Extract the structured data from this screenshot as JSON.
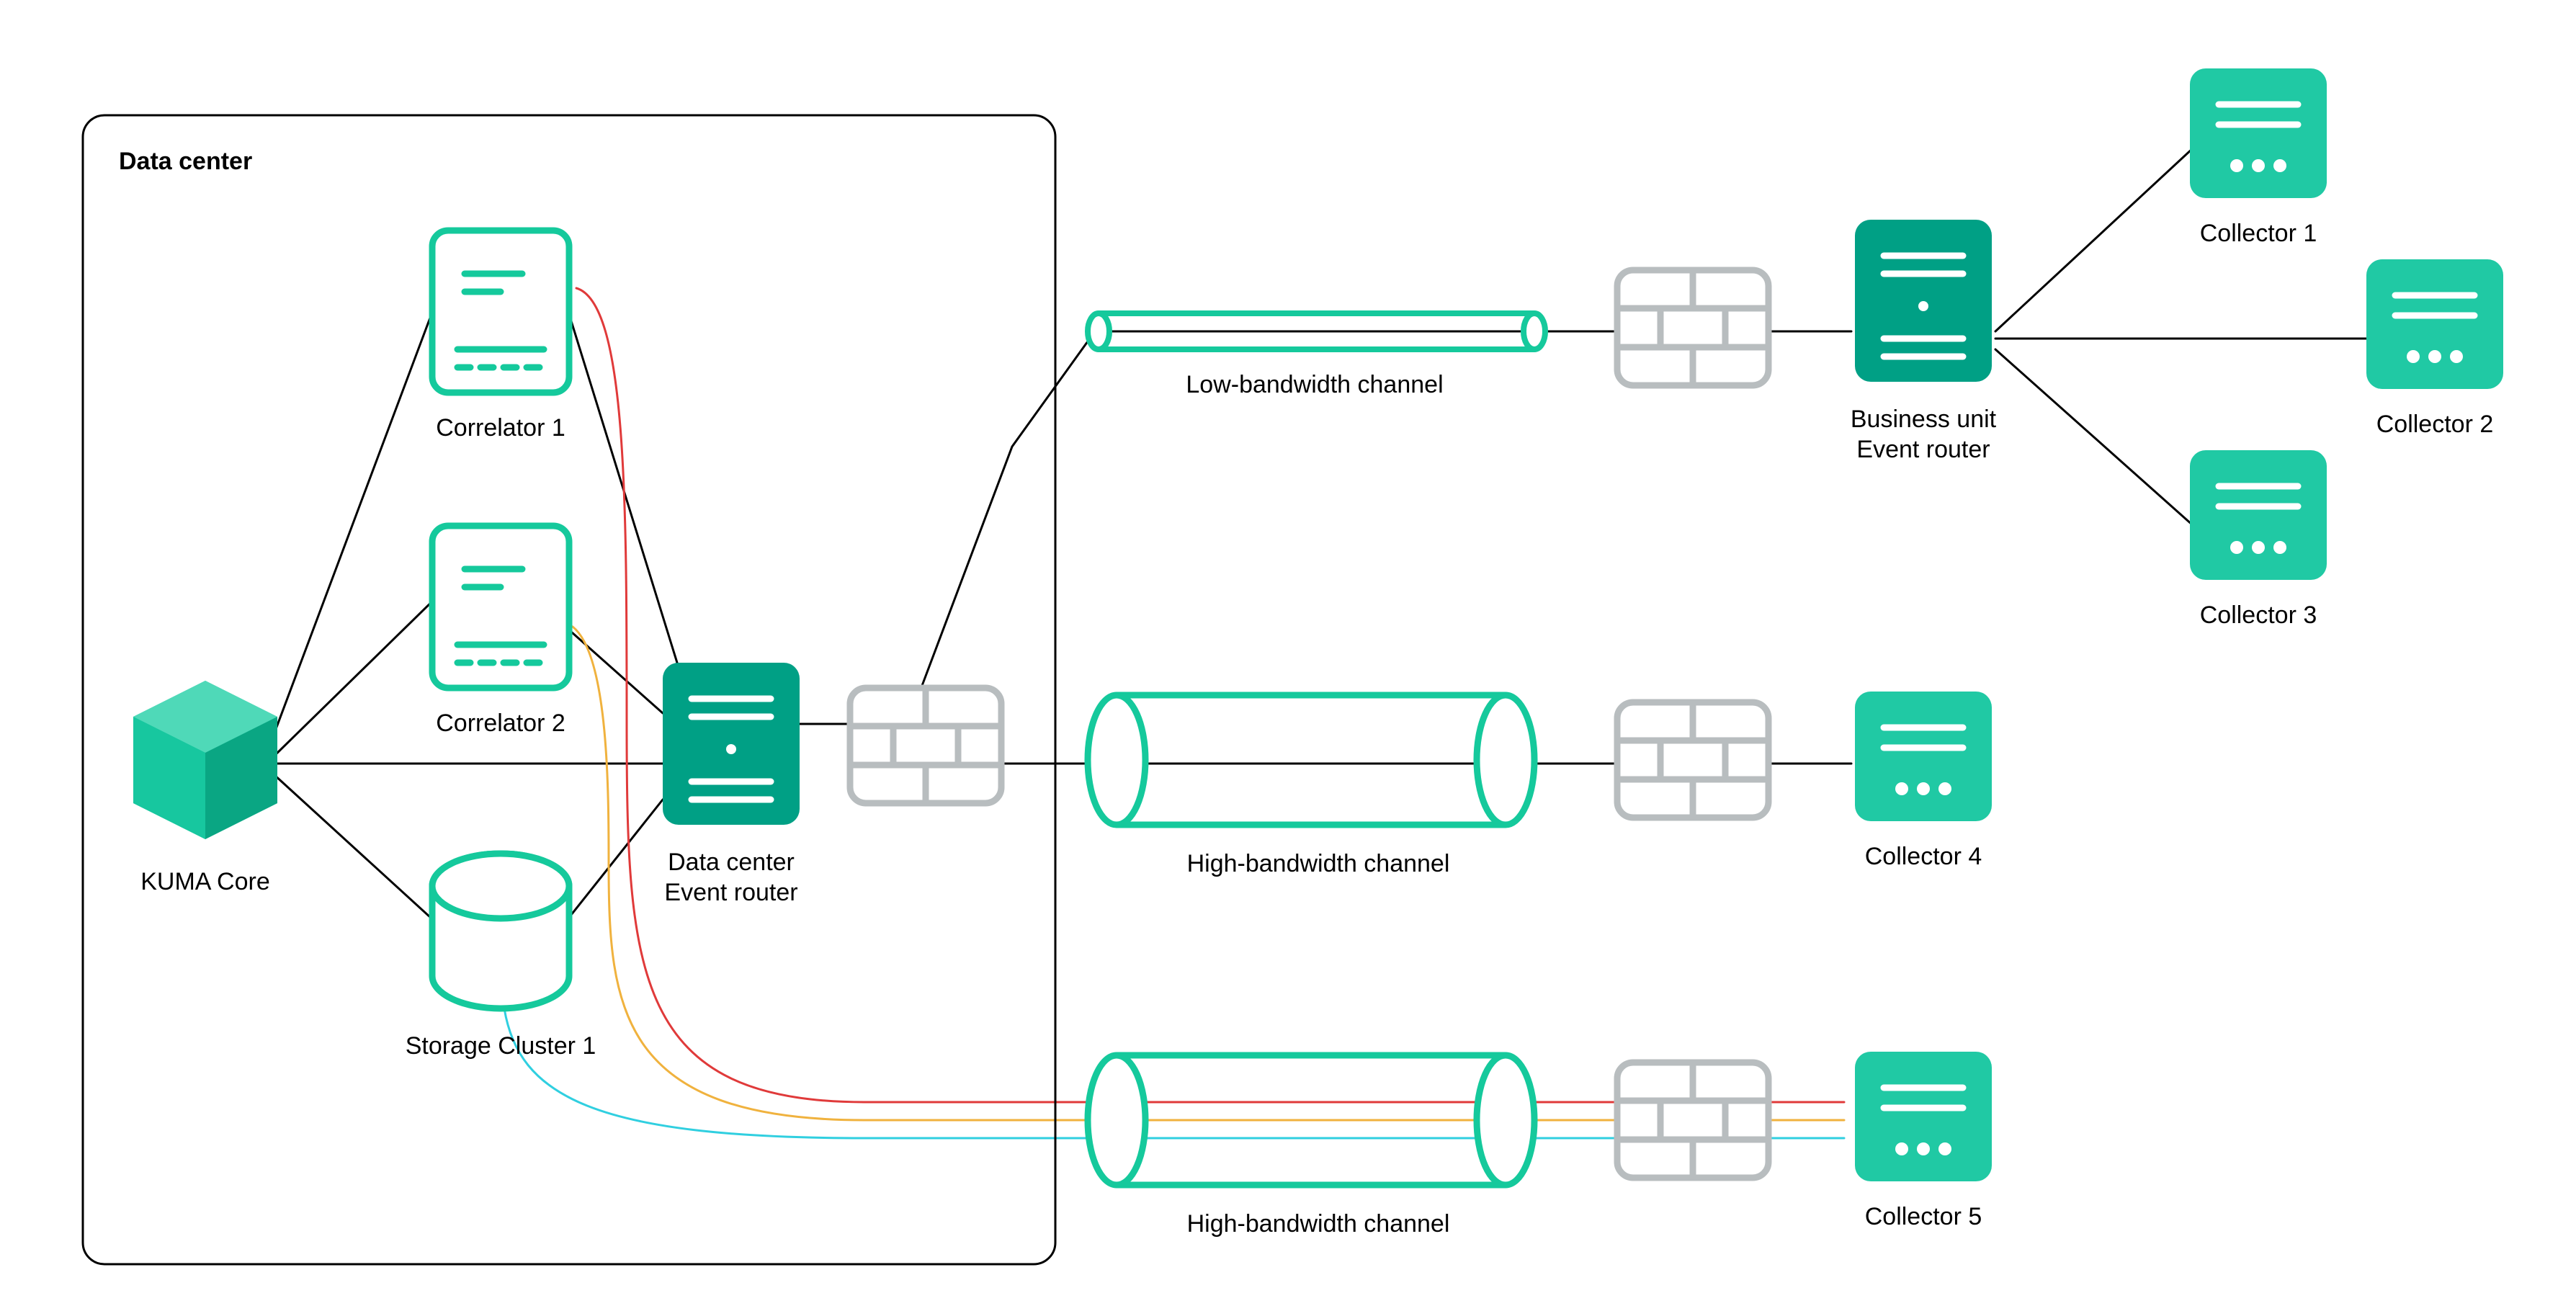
{
  "colors": {
    "teal": "#00b28f",
    "tealLight": "#33c9a8",
    "tealStroke": "#15c99c",
    "tealDark": "#00997a",
    "grey": "#b8bdbf",
    "redLine": "#e03a3a",
    "yellowLine": "#f0b23e",
    "cyanLine": "#30cfe0"
  },
  "container": {
    "label": "Data center"
  },
  "nodes": {
    "kumaCore": {
      "label": "KUMA Core"
    },
    "correlator1": {
      "label": "Correlator 1"
    },
    "correlator2": {
      "label": "Correlator 2"
    },
    "storage": {
      "label": "Storage Cluster 1"
    },
    "dcRouter": {
      "label_line1": "Data center",
      "label_line2": "Event router"
    },
    "buRouter": {
      "label_line1": "Business unit",
      "label_line2": "Event router"
    },
    "collector1": {
      "label": "Collector 1"
    },
    "collector2": {
      "label": "Collector 2"
    },
    "collector3": {
      "label": "Collector 3"
    },
    "collector4": {
      "label": "Collector 4"
    },
    "collector5": {
      "label": "Collector 5"
    }
  },
  "channels": {
    "low": {
      "label": "Low-bandwidth channel"
    },
    "high1": {
      "label": "High-bandwidth channel"
    },
    "high2": {
      "label": "High-bandwidth channel"
    }
  }
}
